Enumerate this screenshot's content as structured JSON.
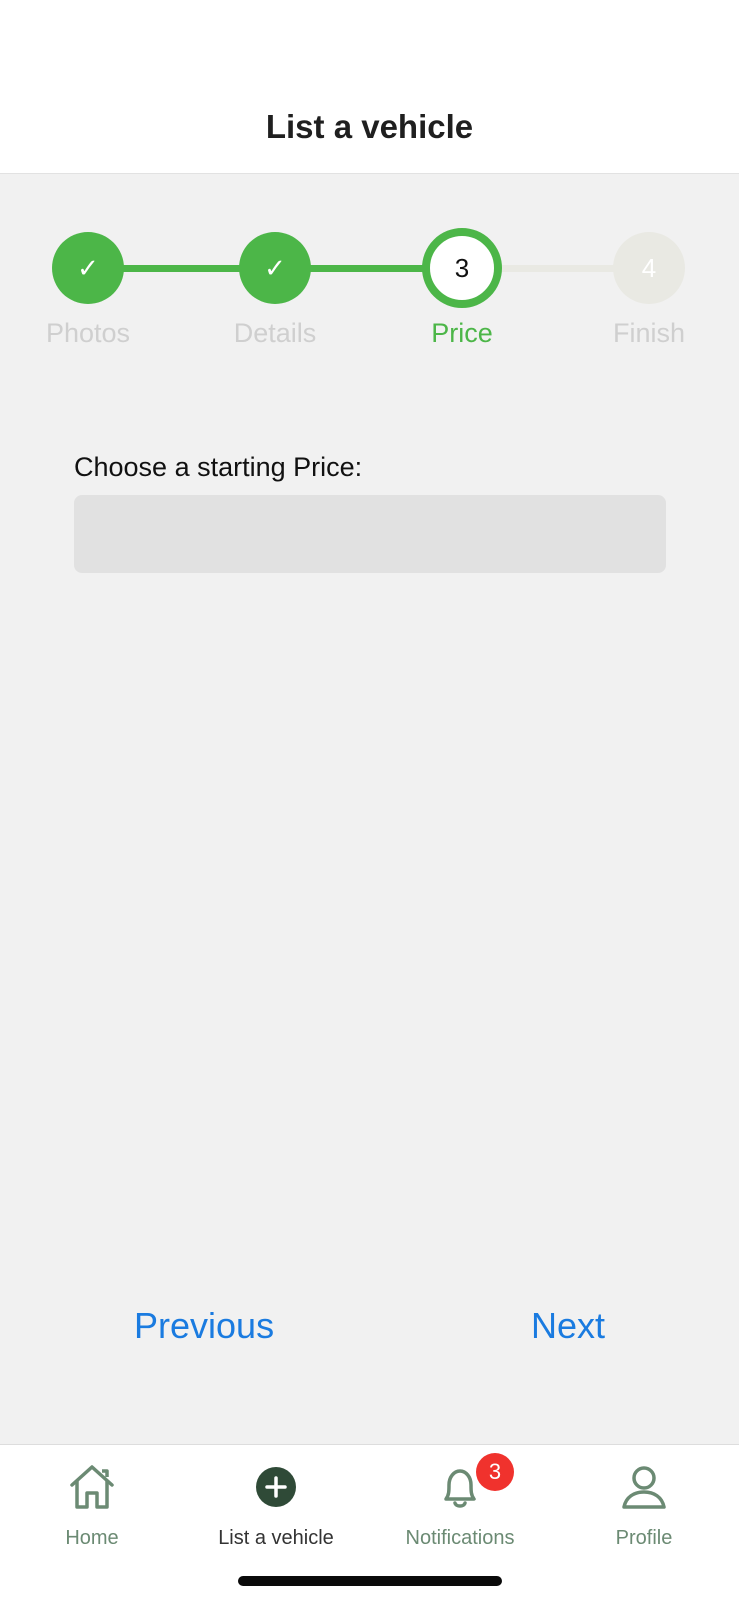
{
  "header": {
    "title": "List a vehicle"
  },
  "stepper": {
    "steps": [
      {
        "label": "Photos",
        "marker": "✓",
        "state": "done"
      },
      {
        "label": "Details",
        "marker": "✓",
        "state": "done"
      },
      {
        "label": "Price",
        "marker": "3",
        "state": "active"
      },
      {
        "label": "Finish",
        "marker": "4",
        "state": "todo"
      }
    ]
  },
  "form": {
    "price_label": "Choose a starting Price:",
    "price_value": "",
    "price_placeholder": ""
  },
  "navigation": {
    "previous_label": "Previous",
    "next_label": "Next"
  },
  "tabbar": {
    "items": [
      {
        "label": "Home",
        "icon": "home-icon"
      },
      {
        "label": "List a vehicle",
        "icon": "plus-circle-icon",
        "active": true
      },
      {
        "label": "Notifications",
        "icon": "bell-icon",
        "badge": "3"
      },
      {
        "label": "Profile",
        "icon": "person-icon"
      }
    ]
  },
  "colors": {
    "accent_green": "#4cb648",
    "link_blue": "#1a7be0",
    "badge_red": "#f0322d",
    "tab_green": "#6b8a73"
  }
}
